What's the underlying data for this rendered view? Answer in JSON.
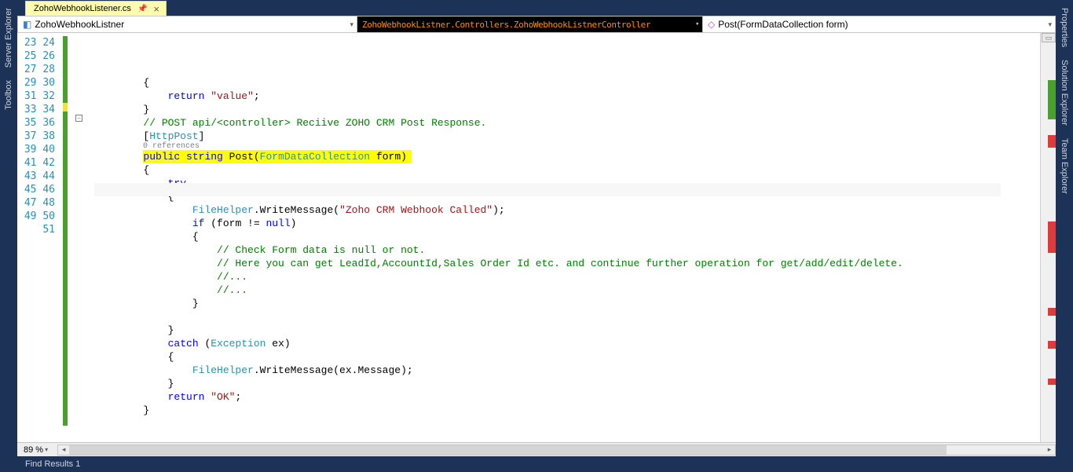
{
  "tab": {
    "title": "ZohoWebhookListener.cs",
    "pinned": true
  },
  "nav": {
    "class_icon": "class-icon",
    "class_name": "ZohoWebhookListner",
    "middle": "ZohoWebhookListner.Controllers.ZohoWebhookListnerController",
    "method_icon": "method-icon",
    "method_name": "Post(FormDataCollection form)"
  },
  "left_rail": [
    "Server Explorer",
    "Toolbox"
  ],
  "right_rail": [
    "Properties",
    "Solution Explorer",
    "Team Explorer"
  ],
  "editor": {
    "first_line": 23,
    "last_line": 51,
    "zoom": "89 %",
    "codelens": "0 references",
    "lines": {
      "l23": "{",
      "l24_a": "return",
      "l24_b": " ",
      "l24_c": "\"value\"",
      "l24_d": ";",
      "l25": "}",
      "l26_a": "// POST api/<controller> Reciive ZOHO CRM Post Response.",
      "l27_a": "[",
      "l27_b": "HttpPost",
      "l27_c": "]",
      "l28_a": "public",
      "l28_b": " ",
      "l28_c": "string",
      "l28_d": " Post(",
      "l28_e": "FormDataCollection",
      "l28_f": " form)",
      "l29": "{",
      "l30": "try",
      "l31": "{",
      "l32_a": "FileHelper",
      "l32_b": ".WriteMessage(",
      "l32_c": "\"Zoho CRM Webhook Called\"",
      "l32_d": ");",
      "l33_a": "if",
      "l33_b": " (form != ",
      "l33_c": "null",
      "l33_d": ")",
      "l34": "{",
      "l35": "// Check Form data is null or not.",
      "l36": "// Here you can get LeadId,AccountId,Sales Order Id etc. and continue further operation for get/add/edit/delete.",
      "l37": "//...",
      "l38": "//...",
      "l39": "}",
      "l40": "",
      "l41": "}",
      "l42_a": "catch",
      "l42_b": " (",
      "l42_c": "Exception",
      "l42_d": " ex)",
      "l43": "{",
      "l44_a": "FileHelper",
      "l44_b": ".WriteMessage(ex.Message);",
      "l45": "}",
      "l46_a": "return",
      "l46_b": " ",
      "l46_c": "\"OK\"",
      "l46_d": ";",
      "l47": "}"
    }
  },
  "bottom": {
    "find_results": "Find Results 1"
  }
}
